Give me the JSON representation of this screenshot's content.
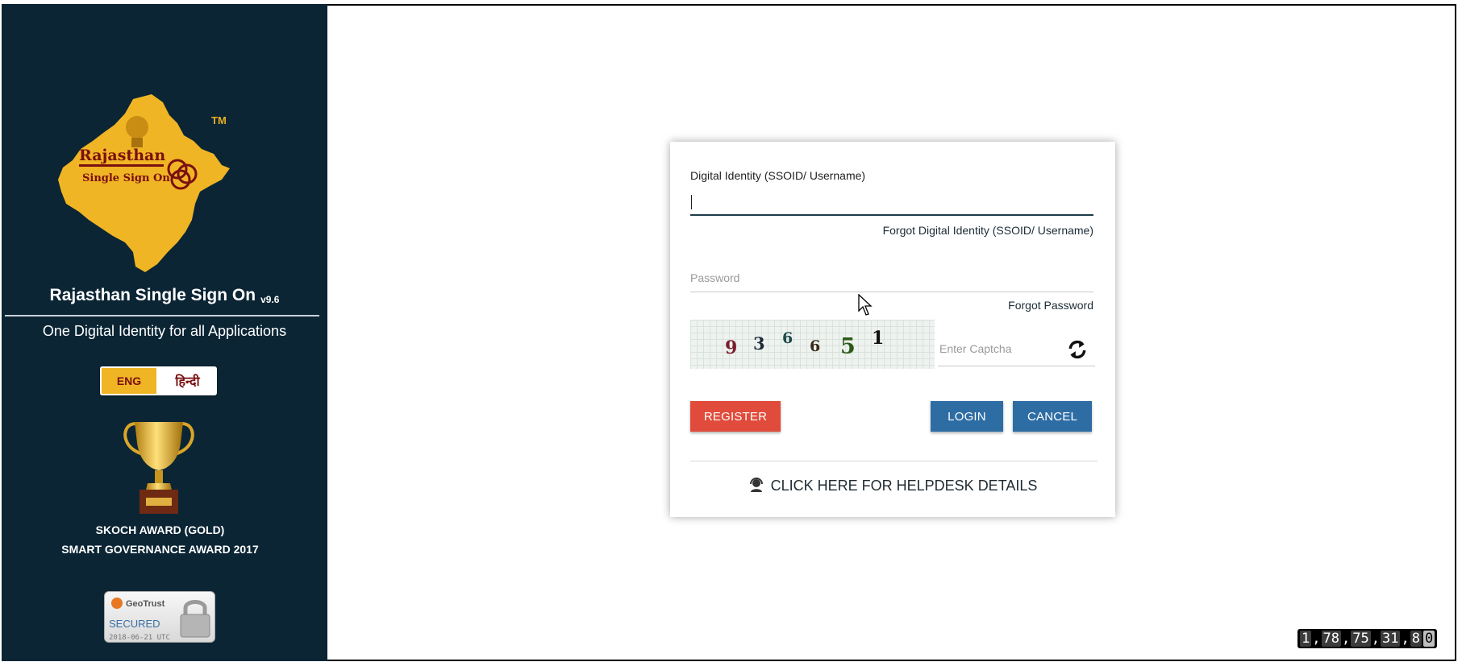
{
  "sidebar": {
    "logo_text_line1": "Rajasthan",
    "logo_text_line2": "Single Sign On",
    "tm": "TM",
    "title": "Rajasthan Single Sign On",
    "version": "v9.6",
    "tagline": "One Digital Identity for all Applications",
    "lang_eng": "ENG",
    "lang_hindi": "हिन्दी",
    "award_line1": "SKOCH AWARD (GOLD)",
    "award_line2": "SMART GOVERNANCE AWARD 2017",
    "seal_brand": "GeoTrust",
    "seal_status": "SECURED",
    "seal_date": "2018-06-21 UTC"
  },
  "login": {
    "ssoid_label": "Digital Identity (SSOID/ Username)",
    "ssoid_value": "",
    "forgot_ssoid": "Forgot Digital Identity (SSOID/ Username)",
    "password_placeholder": "Password",
    "forgot_password": "Forgot Password",
    "captcha_digits": [
      "9",
      "3",
      "6",
      "6",
      "5",
      "1"
    ],
    "captcha_placeholder": "Enter Captcha",
    "register_label": "REGISTER",
    "login_label": "LOGIN",
    "cancel_label": "CANCEL",
    "helpdesk_label": "CLICK HERE FOR HELPDESK DETAILS"
  },
  "counter": {
    "parts": [
      "1",
      "78",
      "75",
      "31",
      "8",
      "0"
    ]
  },
  "colors": {
    "sidebar_bg": "#0b2535",
    "map_gold": "#f0b524",
    "register": "#e04b3b",
    "primary": "#2e6da4"
  },
  "icons": [
    "rajasthan-map-logo",
    "trophy-icon",
    "geotrust-seal",
    "refresh-icon",
    "helpdesk-icon",
    "mouse-cursor-icon"
  ]
}
